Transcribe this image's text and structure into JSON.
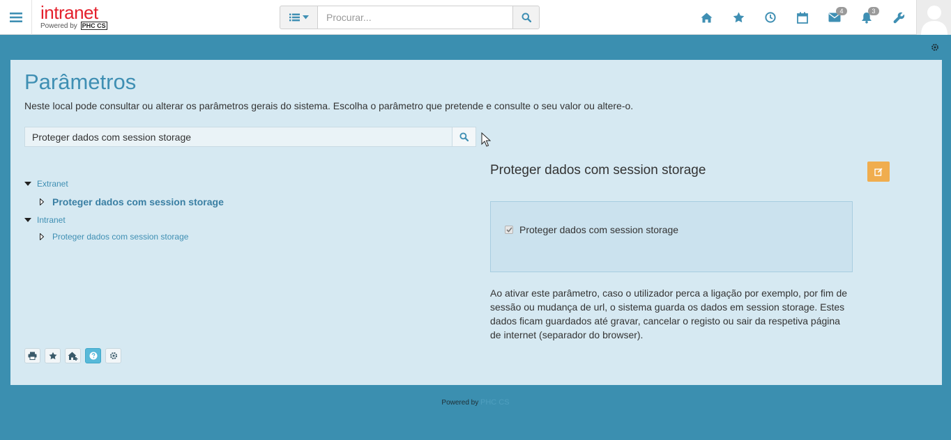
{
  "header": {
    "brand": "intranet",
    "powered_label": "Powered by",
    "powered_brand": "PHC CS",
    "search_placeholder": "Procurar...",
    "badges": {
      "messages": "4",
      "notifications": "3"
    }
  },
  "page": {
    "title": "Parâmetros",
    "description": "Neste local pode consultar ou alterar os parâmetros gerais do sistema. Escolha o parâmetro que pretende e consulte o seu valor ou altere-o.",
    "search_value": "Proteger dados com session storage"
  },
  "tree": [
    {
      "label": "Extranet",
      "children": [
        {
          "label": "Proteger dados com session storage"
        }
      ]
    },
    {
      "label": "Intranet",
      "children": [
        {
          "label": "Proteger dados com session storage"
        }
      ]
    }
  ],
  "detail": {
    "title": "Proteger dados com session storage",
    "checkbox_label": "Proteger dados com session storage",
    "checked": true,
    "help": "Ao ativar este parâmetro, caso o utilizador perca a ligação por exemplo, por fim de sessão ou mudança de url, o sistema guarda os dados em session storage. Estes dados ficam guardados até gravar, cancelar o registo ou sair da respetiva página de internet (separador do browser)."
  },
  "footer": {
    "powered_label": "Powered by",
    "brand": "PHC CS"
  },
  "colors": {
    "accent": "#3f8fb3",
    "background": "#3b8fb0",
    "panel": "#d6e9f2",
    "edit": "#f0ad4e"
  },
  "icons": [
    "menu-icon",
    "list-icon",
    "caret-down-icon",
    "search-icon",
    "home-icon",
    "star-icon",
    "clock-icon",
    "calendar-icon",
    "mail-icon",
    "bell-icon",
    "wrench-icon",
    "user-icon",
    "gear-icon",
    "print-icon",
    "home-add-icon",
    "help-icon",
    "edit-icon"
  ]
}
